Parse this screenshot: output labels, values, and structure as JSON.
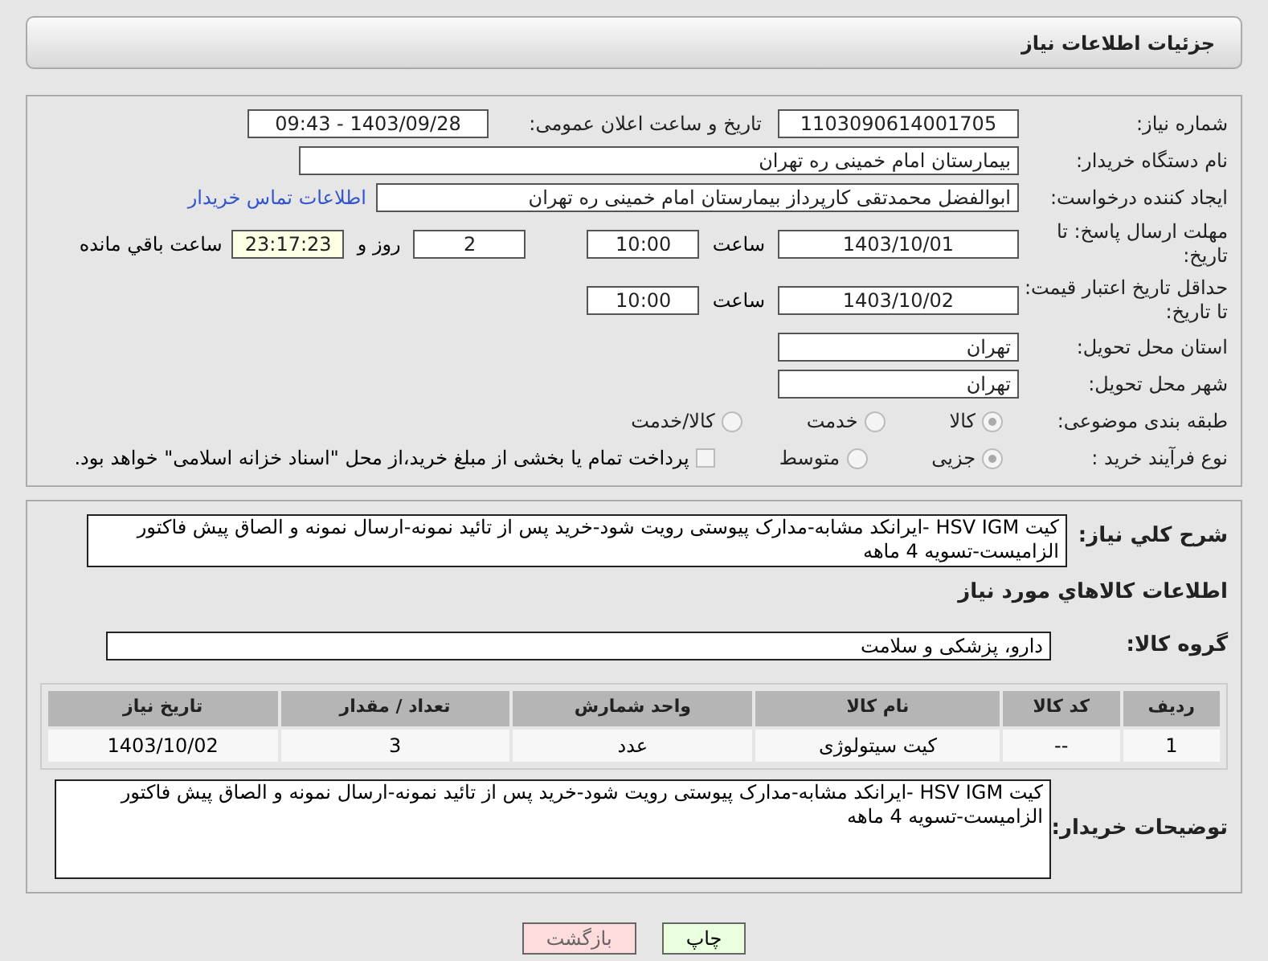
{
  "header": {
    "title": "جزئیات اطلاعات نیاز"
  },
  "need_number": {
    "label": "شماره نیاز:",
    "value": "1103090614001705"
  },
  "announce": {
    "label": "تاریخ و ساعت اعلان عمومی:",
    "value": "1403/09/28 - 09:43"
  },
  "buyer": {
    "label": "نام دستگاه خریدار:",
    "value": "بیمارستان امام خمینی ره  تهران"
  },
  "creator": {
    "label": "ایجاد کننده درخواست:",
    "value": "ابوالفضل محمدتقی کارپرداز بیمارستان امام خمینی ره  تهران",
    "link": "اطلاعات تماس خریدار"
  },
  "deadline": {
    "label": "مهلت ارسال پاسخ: تا تاریخ:",
    "date": "1403/10/01",
    "time_label": "ساعت",
    "time": "10:00",
    "days": "2",
    "days_label": "روز و",
    "remaining": "23:17:23",
    "remaining_label": "ساعت باقي مانده"
  },
  "validity": {
    "label": "حداقل تاریخ اعتبار قیمت: تا تاریخ:",
    "date": "1403/10/02",
    "time_label": "ساعت",
    "time": "10:00"
  },
  "province": {
    "label": "استان محل تحویل:",
    "value": "تهران"
  },
  "city": {
    "label": "شهر محل تحویل:",
    "value": "تهران"
  },
  "category": {
    "label": "طبقه بندی موضوعی:",
    "options": [
      {
        "label": "کالا",
        "selected": true
      },
      {
        "label": "خدمت",
        "selected": false
      },
      {
        "label": "کالا/خدمت",
        "selected": false
      }
    ]
  },
  "process": {
    "label": "نوع فرآیند خرید :",
    "options": [
      {
        "label": "جزیی",
        "selected": true
      },
      {
        "label": "متوسط",
        "selected": false
      }
    ],
    "treasury": {
      "label": "پرداخت تمام یا بخشی از مبلغ خرید،از محل \"اسناد خزانه اسلامی\" خواهد بود.",
      "checked": false
    }
  },
  "description": {
    "label": "شرح كلي نیاز:",
    "value": "کیت HSV IGM -ایرانکد مشابه-مدارک پیوستی رویت شود-خرید پس از تائید نمونه-ارسال نمونه و الصاق پیش فاکتور الزامیست-تسویه 4 ماهه"
  },
  "goods_heading": "اطلاعات كالاهاي مورد نیاز",
  "goods_group": {
    "label": "گروه کالا:",
    "value": "دارو، پزشکی و سلامت"
  },
  "table": {
    "columns": [
      "ردیف",
      "کد کالا",
      "نام کالا",
      "واحد شمارش",
      "تعداد / مقدار",
      "تاریخ نیاز"
    ],
    "rows": [
      [
        "1",
        "--",
        "کیت سیتولوژی",
        "عدد",
        "3",
        "1403/10/02"
      ]
    ]
  },
  "buyer_notes": {
    "label": "توضیحات خریدار:",
    "value": "کیت HSV IGM -ایرانکد مشابه-مدارک پیوستی رویت شود-خرید پس از تائید نمونه-ارسال نمونه و الصاق پیش فاکتور الزامیست-تسویه 4 ماهه"
  },
  "buttons": [
    {
      "label": "چاپ",
      "kind": "print"
    },
    {
      "label": "بازگشت",
      "kind": "back"
    }
  ]
}
